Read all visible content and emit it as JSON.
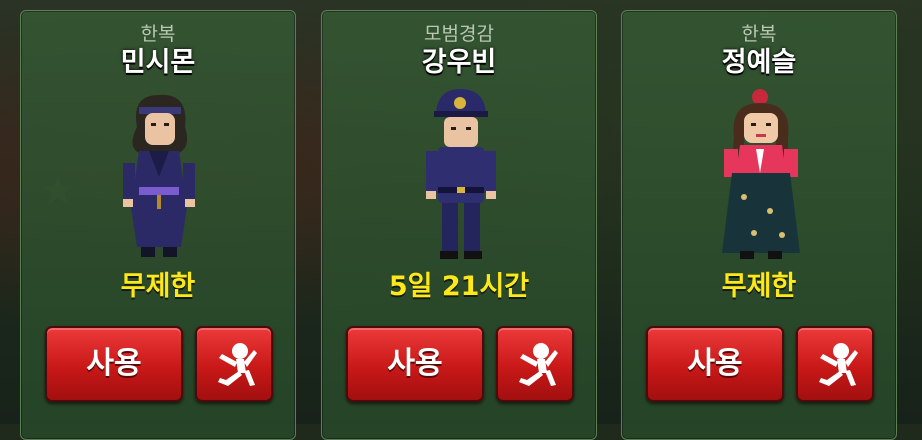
{
  "cards": [
    {
      "outfit": "한복",
      "name": "민시몬",
      "duration": "무제한",
      "use_label": "사용",
      "pose_icon": "pose-icon"
    },
    {
      "outfit": "모범경감",
      "name": "강우빈",
      "duration": "5일 21시간",
      "use_label": "사용",
      "pose_icon": "pose-icon"
    },
    {
      "outfit": "한복",
      "name": "정예슬",
      "duration": "무제한",
      "use_label": "사용",
      "pose_icon": "pose-icon"
    }
  ],
  "colors": {
    "duration": "#ffe81a",
    "button": "#d42020",
    "card": "#33553a"
  }
}
